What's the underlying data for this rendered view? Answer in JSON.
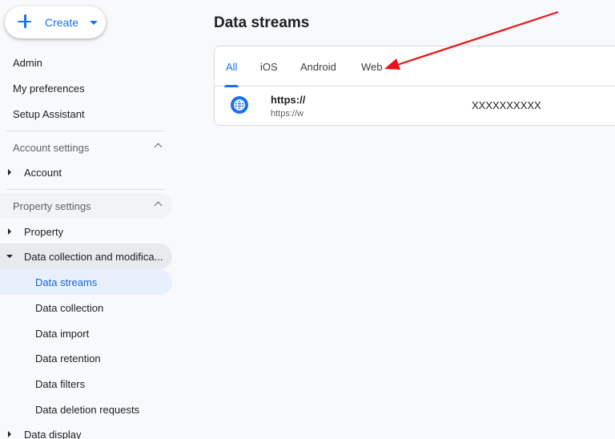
{
  "sidebar": {
    "create_label": "Create",
    "admin": "Admin",
    "my_preferences": "My preferences",
    "setup_assistant": "Setup Assistant",
    "account_settings": "Account settings",
    "account": "Account",
    "property_settings": "Property settings",
    "property": "Property",
    "data_collection_modification": "Data collection and modifica...",
    "sub_items": [
      "Data streams",
      "Data collection",
      "Data import",
      "Data retention",
      "Data filters",
      "Data deletion requests"
    ],
    "data_display": "Data display"
  },
  "main": {
    "title": "Data streams",
    "tabs": [
      "All",
      "iOS",
      "Android",
      "Web"
    ],
    "active_tab": "All",
    "stream": {
      "name": "https://",
      "url": "https://w",
      "id": "XXXXXXXXXX"
    }
  },
  "colors": {
    "accent": "#1a73e8",
    "annotation_arrow": "#e8141a"
  }
}
